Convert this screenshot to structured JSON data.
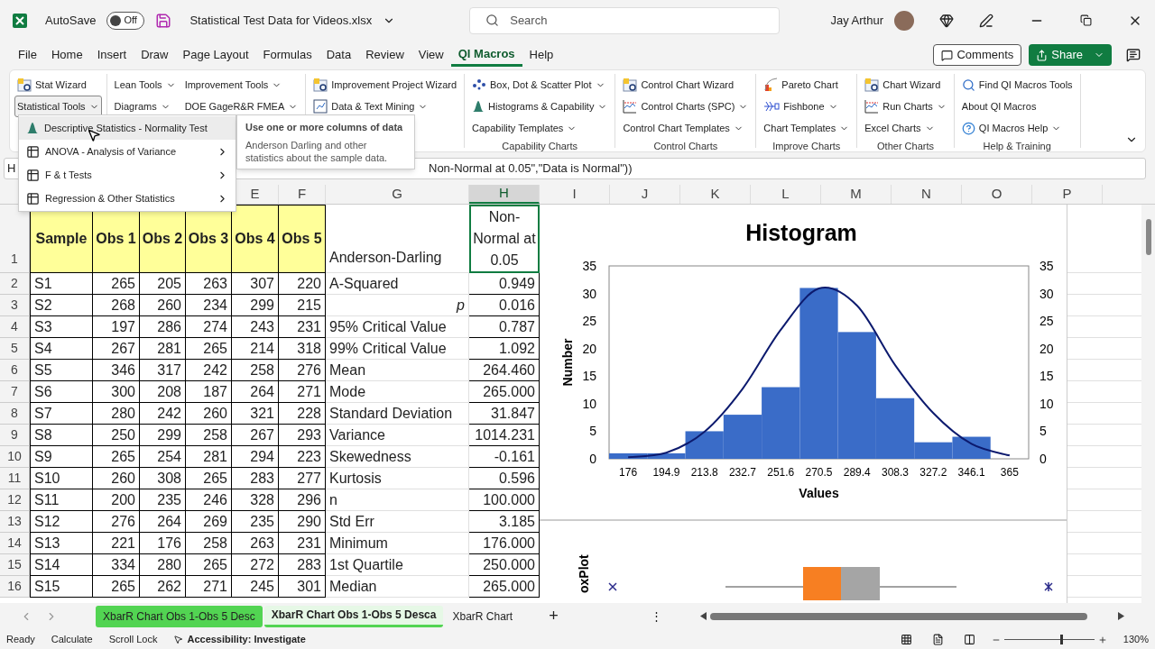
{
  "title_bar": {
    "autosave_label": "AutoSave",
    "autosave": {
      "on": false,
      "label": "Off"
    },
    "filename": "Statistical Test Data for Videos.xlsx",
    "search": {
      "placeholder": "Search"
    },
    "user": "Jay Arthur"
  },
  "menu": [
    {
      "label": "File",
      "selected": false
    },
    {
      "label": "Home",
      "selected": false
    },
    {
      "label": "Insert",
      "selected": false
    },
    {
      "label": "Draw",
      "selected": false
    },
    {
      "label": "Page Layout",
      "selected": false
    },
    {
      "label": "Formulas",
      "selected": false
    },
    {
      "label": "Data",
      "selected": false
    },
    {
      "label": "Review",
      "selected": false
    },
    {
      "label": "View",
      "selected": false
    },
    {
      "label": "QI Macros",
      "selected": true
    },
    {
      "label": "Help",
      "selected": false
    }
  ],
  "comments_button": "Comments",
  "share_button": "Share",
  "ribbon": [
    {
      "items": [
        {
          "label": "Stat Wizard",
          "dropdown": false,
          "open": false
        },
        {
          "label": "Statistical Tools",
          "dropdown": true,
          "open": true
        }
      ]
    },
    {
      "items": [
        {
          "label": "Lean Tools",
          "dropdown": true
        },
        {
          "label": "Improvement Tools",
          "dropdown": true
        },
        {
          "label": "Diagrams",
          "dropdown": true
        },
        {
          "label": "DOE GageR&R FMEA",
          "dropdown": true
        }
      ]
    },
    {
      "items": [
        {
          "label": "Improvement Project Wizard",
          "dropdown": false
        },
        {
          "label": "Data & Text Mining",
          "dropdown": true
        }
      ]
    },
    {
      "label": "Capability Charts",
      "items": [
        {
          "label": "Box, Dot & Scatter Plot",
          "dropdown": true
        },
        {
          "label": "Histograms & Capability",
          "dropdown": true
        },
        {
          "label": "Capability Templates",
          "dropdown": true
        }
      ]
    },
    {
      "label": "Control Charts",
      "items": [
        {
          "label": "Control Chart Wizard",
          "dropdown": false
        },
        {
          "label": "Control Charts (SPC)",
          "dropdown": true
        },
        {
          "label": "Control Chart Templates",
          "dropdown": true
        }
      ]
    },
    {
      "label": "Improve Charts",
      "items": [
        {
          "label": "Pareto Chart",
          "dropdown": false
        },
        {
          "label": "Fishbone",
          "dropdown": true
        },
        {
          "label": "Chart Templates",
          "dropdown": true
        }
      ]
    },
    {
      "label": "Other Charts",
      "items": [
        {
          "label": "Chart Wizard",
          "dropdown": false
        },
        {
          "label": "Run Charts",
          "dropdown": true
        },
        {
          "label": "Excel Charts",
          "dropdown": true
        }
      ]
    },
    {
      "label": "Help & Training",
      "items": [
        {
          "label": "Find QI Macros Tools",
          "dropdown": false
        },
        {
          "label": "About QI Macros",
          "dropdown": false
        },
        {
          "label": "QI Macros Help",
          "dropdown": true
        }
      ]
    }
  ],
  "dropdown_menu": [
    {
      "label": "Descriptive Statistics - Normality Test",
      "submenu": false,
      "selected": true
    },
    {
      "label": "ANOVA - Analysis of Variance",
      "submenu": true,
      "selected": false
    },
    {
      "label": "F & t Tests",
      "submenu": true,
      "selected": false
    },
    {
      "label": "Regression & Other Statistics",
      "submenu": true,
      "selected": false
    }
  ],
  "tooltip": {
    "title": "Use one or more columns of data",
    "body": "Anderson Darling and other statistics about the sample data."
  },
  "formula_bar": {
    "name_box": "H",
    "formula": "Non-Normal at 0.05\",\"Data is Normal\"))"
  },
  "column_headers": [
    "E",
    "F",
    "G",
    "H",
    "I",
    "J",
    "K",
    "L",
    "M",
    "N",
    "O",
    "P"
  ],
  "table": {
    "header_row": "1",
    "header": [
      "Sample",
      "Obs 1",
      "Obs 2",
      "Obs 3",
      "Obs 4",
      "Obs 5"
    ],
    "stat_header": "Anderson-Darling",
    "result_header": "Non-Normal at 0.05",
    "rows": [
      {
        "row": "2",
        "cells": [
          "S1",
          "265",
          "205",
          "263",
          "307",
          "220"
        ],
        "stat": "A-Squared",
        "italic": false,
        "value": "0.949"
      },
      {
        "row": "3",
        "cells": [
          "S2",
          "268",
          "260",
          "234",
          "299",
          "215"
        ],
        "stat": "p",
        "italic": true,
        "value": "0.016"
      },
      {
        "row": "4",
        "cells": [
          "S3",
          "197",
          "286",
          "274",
          "243",
          "231"
        ],
        "stat": "95% Critical Value",
        "italic": false,
        "value": "0.787"
      },
      {
        "row": "5",
        "cells": [
          "S4",
          "267",
          "281",
          "265",
          "214",
          "318"
        ],
        "stat": "99% Critical Value",
        "italic": false,
        "value": "1.092"
      },
      {
        "row": "6",
        "cells": [
          "S5",
          "346",
          "317",
          "242",
          "258",
          "276"
        ],
        "stat": "Mean",
        "italic": false,
        "value": "264.460"
      },
      {
        "row": "7",
        "cells": [
          "S6",
          "300",
          "208",
          "187",
          "264",
          "271"
        ],
        "stat": "Mode",
        "italic": false,
        "value": "265.000"
      },
      {
        "row": "8",
        "cells": [
          "S7",
          "280",
          "242",
          "260",
          "321",
          "228"
        ],
        "stat": "Standard Deviation",
        "italic": false,
        "value": "31.847"
      },
      {
        "row": "9",
        "cells": [
          "S8",
          "250",
          "299",
          "258",
          "267",
          "293"
        ],
        "stat": "Variance",
        "italic": false,
        "value": "1014.231"
      },
      {
        "row": "10",
        "cells": [
          "S9",
          "265",
          "254",
          "281",
          "294",
          "223"
        ],
        "stat": "Skewedness",
        "italic": false,
        "value": "-0.161"
      },
      {
        "row": "11",
        "cells": [
          "S10",
          "260",
          "308",
          "265",
          "283",
          "277"
        ],
        "stat": "Kurtosis",
        "italic": false,
        "value": "0.596"
      },
      {
        "row": "12",
        "cells": [
          "S11",
          "200",
          "235",
          "246",
          "328",
          "296"
        ],
        "stat": "n",
        "italic": false,
        "value": "100.000"
      },
      {
        "row": "13",
        "cells": [
          "S12",
          "276",
          "264",
          "269",
          "235",
          "290"
        ],
        "stat": "Std Err",
        "italic": false,
        "value": "3.185"
      },
      {
        "row": "14",
        "cells": [
          "S13",
          "221",
          "176",
          "258",
          "263",
          "231"
        ],
        "stat": "Minimum",
        "italic": false,
        "value": "176.000"
      },
      {
        "row": "15",
        "cells": [
          "S14",
          "334",
          "280",
          "265",
          "272",
          "283"
        ],
        "stat": "1st Quartile",
        "italic": false,
        "value": "250.000"
      },
      {
        "row": "16",
        "cells": [
          "S15",
          "265",
          "262",
          "271",
          "245",
          "301"
        ],
        "stat": "Median",
        "italic": false,
        "value": "265.000"
      }
    ]
  },
  "histogram": {
    "chart_data": {
      "type": "bar",
      "title": "Histogram",
      "xlabel": "Values",
      "ylabel": "Number",
      "categories": [
        "176",
        "194.9",
        "213.8",
        "232.7",
        "251.6",
        "270.5",
        "289.4",
        "308.3",
        "327.2",
        "346.1",
        "365"
      ],
      "series": [
        {
          "color": "#3a6cc8",
          "values": [
            1,
            1,
            5,
            8,
            13,
            31,
            23,
            11,
            3,
            4,
            0
          ]
        },
        {
          "type": "line",
          "color": "#0c1a6e",
          "values": [
            0.3,
            1.1,
            4.9,
            12.7,
            23.4,
            30.9,
            27.8,
            17,
            8.3,
            2.7,
            0.6
          ]
        }
      ],
      "ylim": [
        0,
        35
      ],
      "yticks": [
        {
          "value": 0,
          "label": "0"
        },
        {
          "value": 5,
          "label": "5"
        },
        {
          "value": 10,
          "label": "10"
        },
        {
          "value": 15,
          "label": "15"
        },
        {
          "value": 20,
          "label": "20"
        },
        {
          "value": 25,
          "label": "25"
        },
        {
          "value": 30,
          "label": "30"
        },
        {
          "value": 35,
          "label": "35"
        }
      ]
    },
    "right_axis_ticks": [
      "35",
      "30",
      "25",
      "20",
      "15",
      "10",
      "5",
      "0"
    ]
  },
  "boxplot": {
    "label": "oxPlot"
  },
  "sheet_tabs": [
    {
      "label": "XbarR Chart Obs 1-Obs 5 Desc",
      "selected": false,
      "color": "#52d452"
    },
    {
      "label": "XbarR Chart Obs 1-Obs 5 Desca",
      "selected": true,
      "color": "#52d452"
    },
    {
      "label": "XbarR Chart",
      "selected": false
    }
  ],
  "add_sheet": "+",
  "more": "⋮",
  "status_bar": {
    "items": [
      "Ready",
      "Calculate",
      "Scroll Lock"
    ],
    "accessibility": "Accessibility: Investigate",
    "zoom": {
      "level": 0.62,
      "label": "130%"
    }
  }
}
